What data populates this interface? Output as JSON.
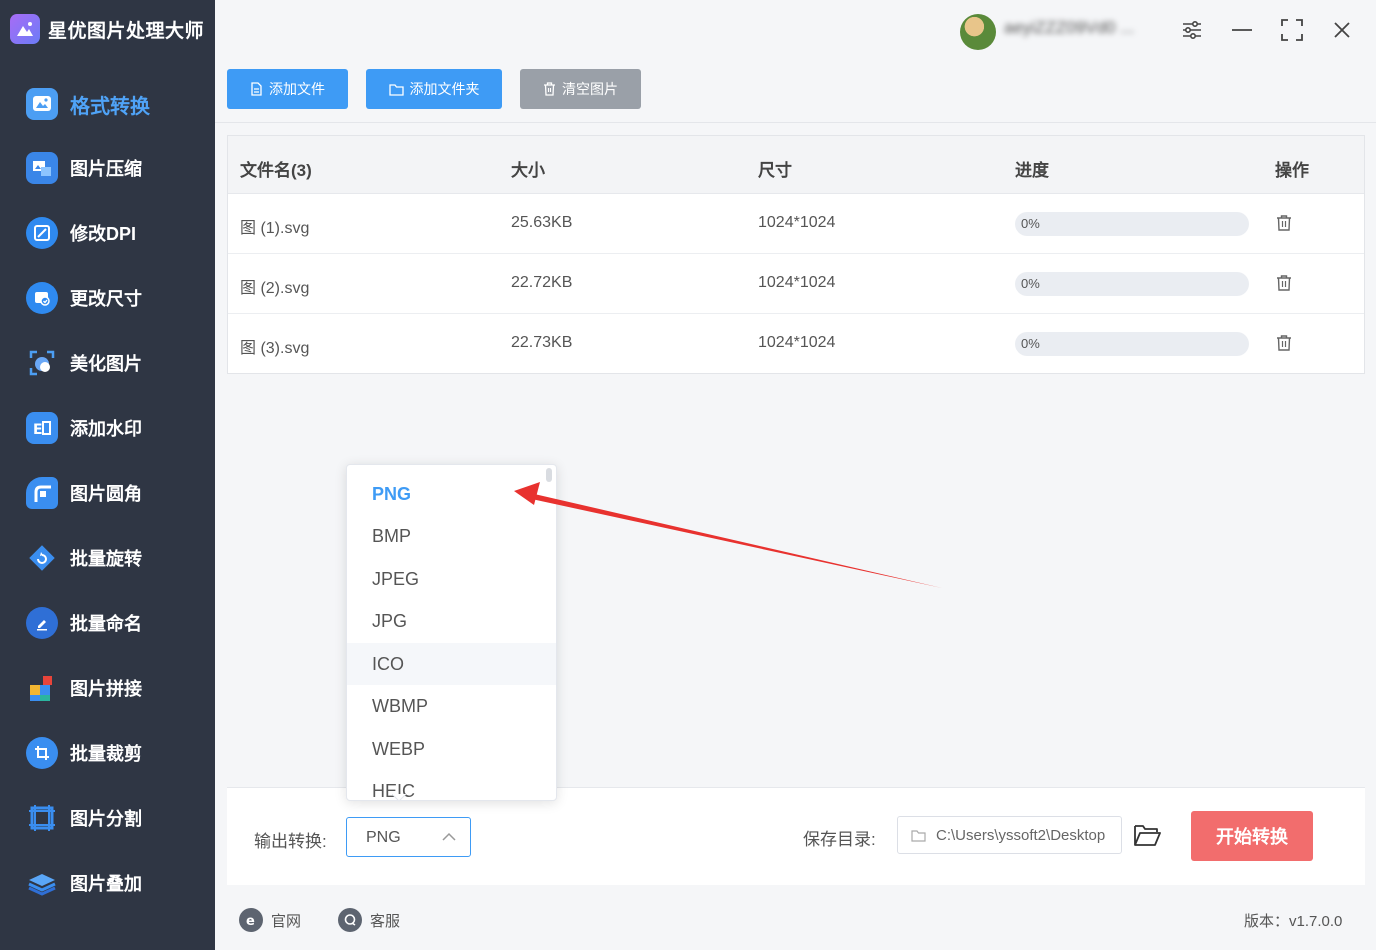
{
  "app": {
    "title": "星优图片处理大师"
  },
  "user": {
    "name": "aeyiZZZ09Vd0 ..."
  },
  "sidebar": {
    "items": [
      {
        "label": "格式转换",
        "icon": "format-convert-icon",
        "active": true
      },
      {
        "label": "图片压缩",
        "icon": "image-compress-icon"
      },
      {
        "label": "修改DPI",
        "icon": "dpi-icon"
      },
      {
        "label": "更改尺寸",
        "icon": "resize-icon"
      },
      {
        "label": "美化图片",
        "icon": "beautify-icon"
      },
      {
        "label": "添加水印",
        "icon": "watermark-icon"
      },
      {
        "label": "图片圆角",
        "icon": "round-corner-icon"
      },
      {
        "label": "批量旋转",
        "icon": "rotate-icon"
      },
      {
        "label": "批量命名",
        "icon": "rename-icon"
      },
      {
        "label": "图片拼接",
        "icon": "stitch-icon"
      },
      {
        "label": "批量裁剪",
        "icon": "crop-icon"
      },
      {
        "label": "图片分割",
        "icon": "split-icon"
      },
      {
        "label": "图片叠加",
        "icon": "overlay-icon"
      }
    ]
  },
  "toolbar": {
    "add_file": "添加文件",
    "add_folder": "添加文件夹",
    "clear": "清空图片"
  },
  "table": {
    "headers": [
      "文件名(3)",
      "大小",
      "尺寸",
      "进度",
      "操作"
    ],
    "rows": [
      {
        "name": "图 (1).svg",
        "size": "25.63KB",
        "dims": "1024*1024",
        "progress": "0%"
      },
      {
        "name": "图 (2).svg",
        "size": "22.72KB",
        "dims": "1024*1024",
        "progress": "0%"
      },
      {
        "name": "图 (3).svg",
        "size": "22.73KB",
        "dims": "1024*1024",
        "progress": "0%"
      }
    ]
  },
  "dropdown": {
    "options": [
      "PNG",
      "BMP",
      "JPEG",
      "JPG",
      "ICO",
      "WBMP",
      "WEBP",
      "HEIC"
    ],
    "selected": "PNG",
    "hovered": "ICO"
  },
  "bottom": {
    "output_label": "输出转换:",
    "output_value": "PNG",
    "save_label": "保存目录:",
    "save_path": "C:\\Users\\yssoft2\\Desktop",
    "start": "开始转换"
  },
  "footer": {
    "website": "官网",
    "support": "客服",
    "version": "版本：v1.7.0.0"
  },
  "colors": {
    "accent": "#3e9bf5",
    "sidebar_bg": "#2f3644",
    "start_button": "#f26d6d",
    "annotation_arrow": "#e8322f"
  }
}
